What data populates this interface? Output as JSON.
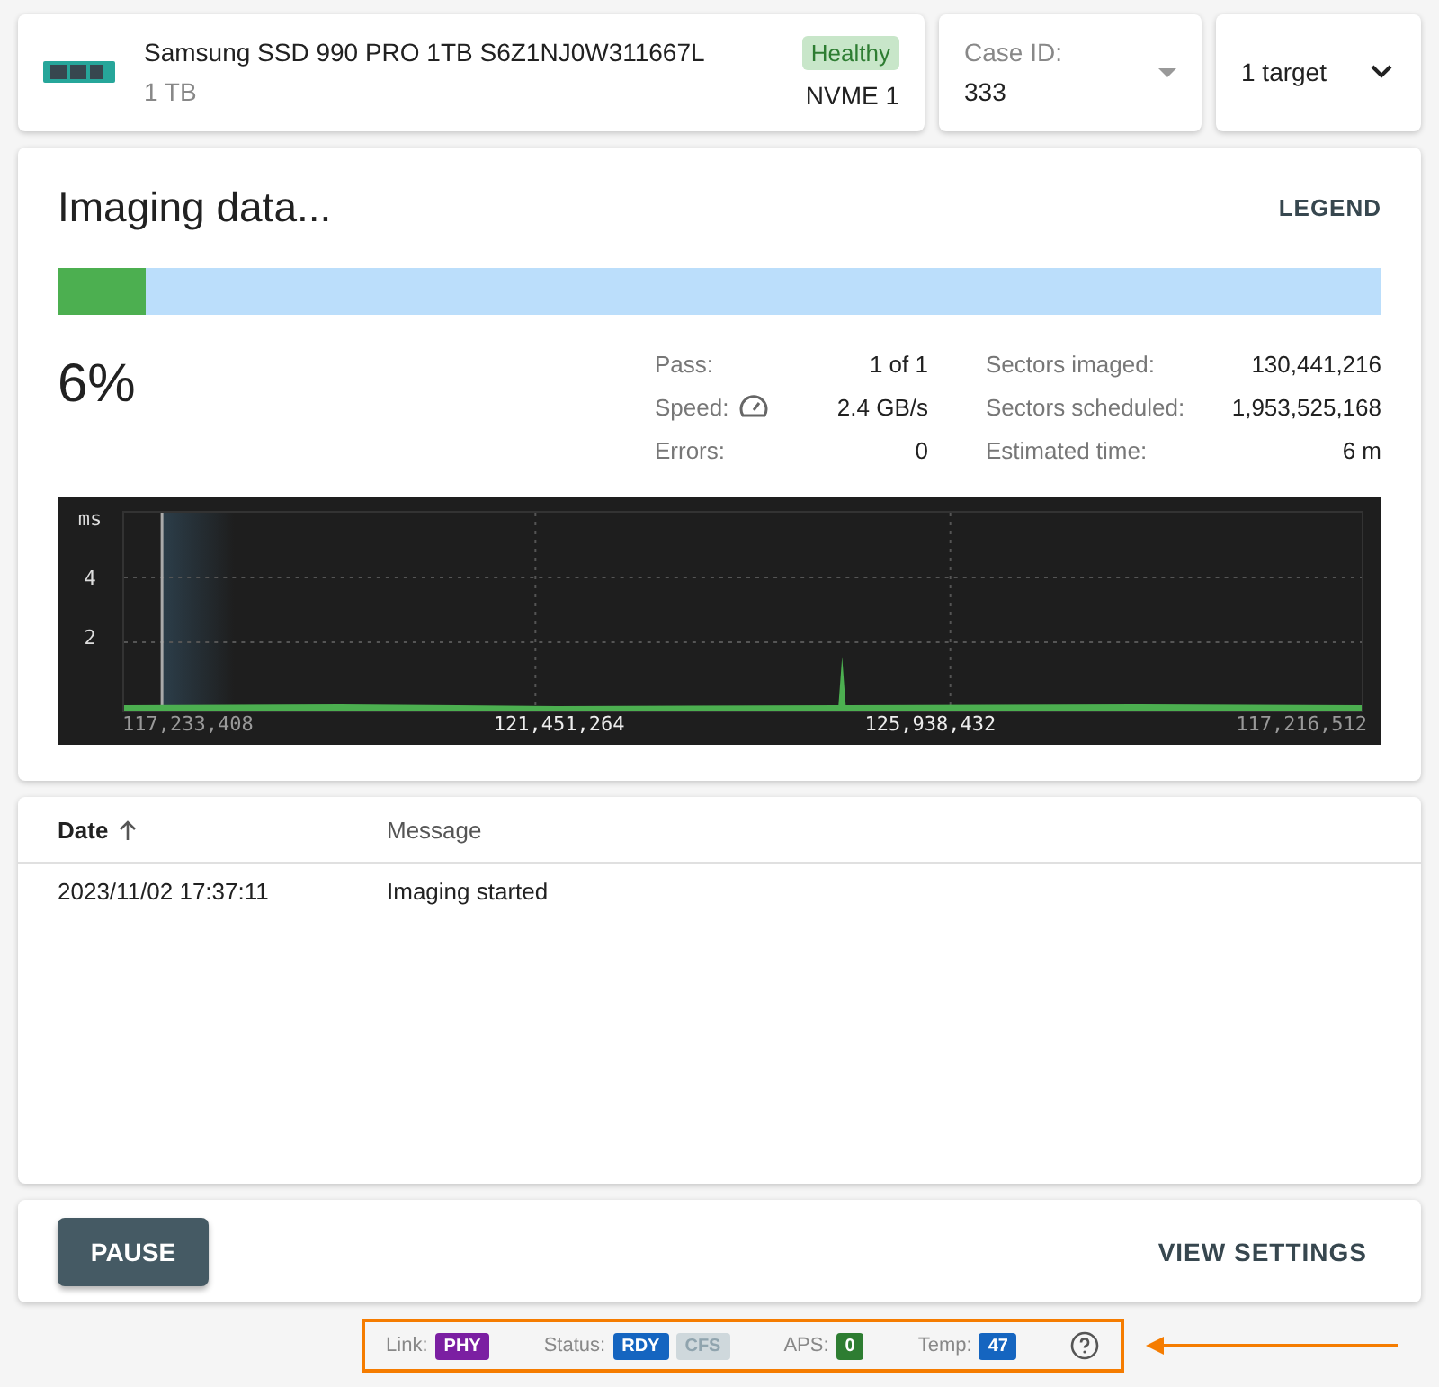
{
  "device": {
    "name": "Samsung SSD 990 PRO 1TB S6Z1NJ0W311667L",
    "capacity": "1 TB",
    "health": "Healthy",
    "interface": "NVME 1"
  },
  "case": {
    "label": "Case ID:",
    "value": "333"
  },
  "targets": {
    "label": "1 target"
  },
  "imaging": {
    "title": "Imaging data...",
    "legend": "LEGEND",
    "level": 0.067,
    "percent": "6%",
    "stats_left": [
      {
        "label": "Pass:",
        "value": "1 of 1",
        "kind": "plain"
      },
      {
        "label": "Speed:",
        "value": "2.4 GB/s",
        "kind": "speed"
      },
      {
        "label": "Errors:",
        "value": "0",
        "kind": "plain"
      }
    ],
    "stats_right": [
      {
        "label": "Sectors imaged:",
        "value": "130,441,216"
      },
      {
        "label": "Sectors scheduled:",
        "value": "1,953,525,168"
      },
      {
        "label": "Estimated time:",
        "value": "6 m"
      }
    ],
    "graph": {
      "unit": "ms",
      "y_labels": [
        "4",
        "2"
      ],
      "x_labels": [
        {
          "text": "117,233,408",
          "bright": false
        },
        {
          "text": "121,451,264",
          "bright": true
        },
        {
          "text": "125,938,432",
          "bright": true
        },
        {
          "text": "117,216,512",
          "bright": false
        }
      ]
    }
  },
  "log": {
    "columns": [
      {
        "label": "Date",
        "sorted": true
      },
      {
        "label": "Message",
        "sorted": false
      }
    ],
    "rows": [
      [
        "2023/11/02 17:37:11",
        "Imaging started"
      ]
    ]
  },
  "actions": {
    "primary": "PAUSE",
    "secondary": "VIEW SETTINGS"
  },
  "status_bar": [
    {
      "label": "Link:",
      "badges": [
        {
          "text": "PHY",
          "color": "#7b1fa2",
          "on": true
        }
      ]
    },
    {
      "label": "Status:",
      "badges": [
        {
          "text": "RDY",
          "color": "#1565c0",
          "on": true
        },
        {
          "text": "CFS",
          "on": false
        }
      ]
    },
    {
      "label": "APS:",
      "badges": [
        {
          "text": "0",
          "color": "#2e7d32",
          "on": true
        }
      ]
    },
    {
      "label": "Temp:",
      "badges": [
        {
          "text": "47",
          "color": "#1565c0",
          "on": true
        }
      ]
    }
  ]
}
